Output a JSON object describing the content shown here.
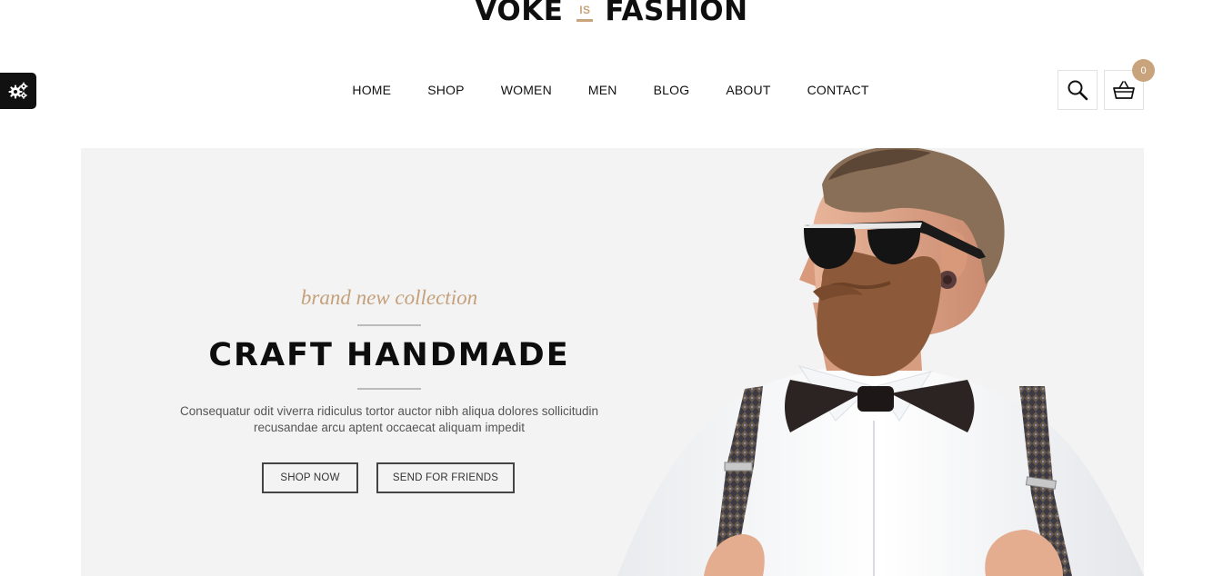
{
  "brand": {
    "left": "VOKE",
    "middle": "IS",
    "right": "FASHION",
    "accent_color": "#c9a37b"
  },
  "nav": {
    "items": [
      {
        "label": "HOME"
      },
      {
        "label": "SHOP"
      },
      {
        "label": "WOMEN"
      },
      {
        "label": "MEN"
      },
      {
        "label": "BLOG"
      },
      {
        "label": "ABOUT"
      },
      {
        "label": "CONTACT"
      }
    ]
  },
  "header": {
    "cart_count": "0",
    "settings_icon": "gears-icon",
    "search_icon": "search-icon",
    "cart_icon": "basket-icon"
  },
  "hero": {
    "tagline": "brand new collection",
    "headline": "CRAFT HANDMADE",
    "description_line1": "Consequatur odit viverra ridiculus tortor auctor nibh aliqua dolores sollicitudin",
    "description_line2": "recusandae arcu aptent occaecat aliquam impedit",
    "primary_button": "SHOP NOW",
    "secondary_button": "SEND FOR FRIENDS",
    "background_color": "#f3f3f3"
  }
}
